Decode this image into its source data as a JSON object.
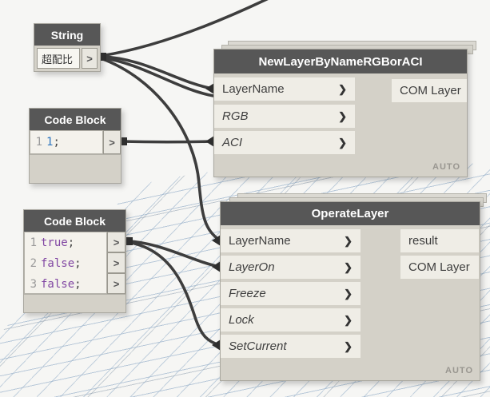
{
  "icons": {
    "chevron": "❯",
    "port": ">"
  },
  "colors": {
    "canvas_bg": "#f6f6f4",
    "grid_line": "#b9cdde",
    "node_header": "#575757",
    "node_body": "#d4d1c8",
    "port_row": "#efede6",
    "wire": "#3d3d3d",
    "number_literal": "#2e76c0",
    "keyword_literal": "#8147a3"
  },
  "nodes": {
    "string": {
      "title": "String",
      "value": "超配比"
    },
    "code_block_1": {
      "title": "Code Block",
      "lines": [
        {
          "num": "1",
          "value": "1",
          "punct": ";",
          "kind": "number"
        }
      ]
    },
    "code_block_2": {
      "title": "Code Block",
      "lines": [
        {
          "num": "1",
          "value": "true",
          "punct": ";",
          "kind": "keyword"
        },
        {
          "num": "2",
          "value": "false",
          "punct": ";",
          "kind": "keyword"
        },
        {
          "num": "3",
          "value": "false",
          "punct": ";",
          "kind": "keyword"
        }
      ]
    },
    "new_layer": {
      "title": "NewLayerByNameRGBorACI",
      "inputs": [
        {
          "label": "LayerName"
        },
        {
          "label": "RGB"
        },
        {
          "label": "ACI"
        }
      ],
      "outputs": [
        {
          "label": "COM Layer"
        }
      ],
      "lacing": "AUTO"
    },
    "operate_layer": {
      "title": "OperateLayer",
      "inputs": [
        {
          "label": "LayerName"
        },
        {
          "label": "LayerOn"
        },
        {
          "label": "Freeze"
        },
        {
          "label": "Lock"
        },
        {
          "label": "SetCurrent"
        }
      ],
      "outputs": [
        {
          "label": "result"
        },
        {
          "label": "COM Layer"
        }
      ],
      "lacing": "AUTO"
    }
  },
  "connections": [
    {
      "from": "String.out",
      "to": "offscreen-top"
    },
    {
      "from": "String.out",
      "to": "NewLayerByNameRGBorACI.LayerName"
    },
    {
      "from": "String.out",
      "to": "offscreen-under-node"
    },
    {
      "from": "String.out",
      "to": "OperateLayer.LayerName"
    },
    {
      "from": "CodeBlock1.out1",
      "to": "NewLayerByNameRGBorACI.ACI"
    },
    {
      "from": "CodeBlock2.out1",
      "to": "OperateLayer.LayerOn"
    },
    {
      "from": "CodeBlock2.out1",
      "to": "OperateLayer.SetCurrent"
    }
  ]
}
